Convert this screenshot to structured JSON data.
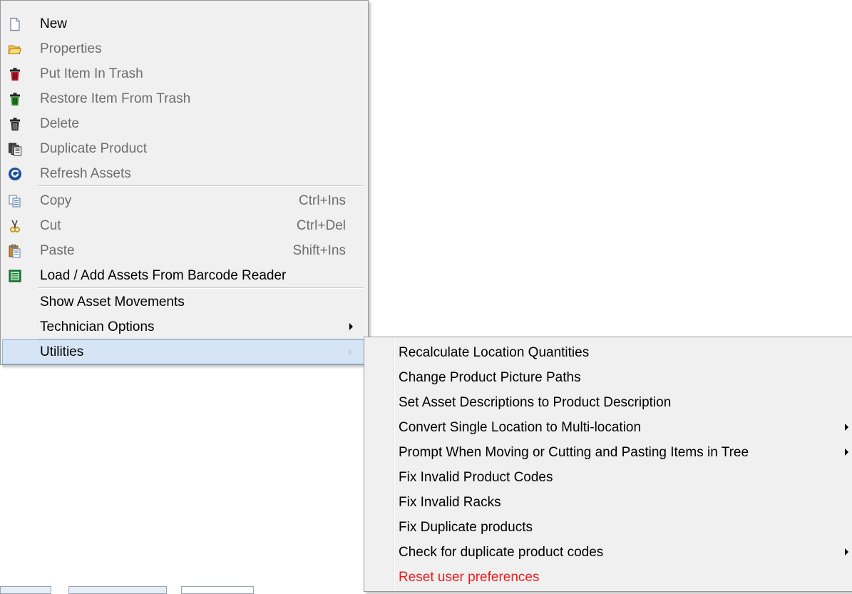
{
  "main_menu": {
    "items": [
      {
        "label": "New",
        "icon": "new-document-icon",
        "enabled": true
      },
      {
        "label": "Properties",
        "icon": "folder-open-icon",
        "enabled": false
      },
      {
        "label": "Put Item In Trash",
        "icon": "trash-red-icon",
        "enabled": false
      },
      {
        "label": "Restore Item From Trash",
        "icon": "trash-green-icon",
        "enabled": false
      },
      {
        "label": "Delete",
        "icon": "trash-black-icon",
        "enabled": false
      },
      {
        "label": "Duplicate Product",
        "icon": "duplicate-icon",
        "enabled": false
      },
      {
        "label": "Refresh Assets",
        "icon": "refresh-icon",
        "enabled": false
      },
      {
        "label": "Copy",
        "icon": "copy-icon",
        "shortcut": "Ctrl+Ins",
        "enabled": false
      },
      {
        "label": "Cut",
        "icon": "scissors-icon",
        "shortcut": "Ctrl+Del",
        "enabled": false
      },
      {
        "label": "Paste",
        "icon": "paste-icon",
        "shortcut": "Shift+Ins",
        "enabled": false
      },
      {
        "label": "Load / Add Assets From Barcode Reader",
        "icon": "barcode-list-icon",
        "enabled": true
      },
      {
        "label": "Show Asset Movements",
        "enabled": true
      },
      {
        "label": "Technician Options",
        "enabled": true,
        "has_submenu": true
      },
      {
        "label": "Utilities",
        "enabled": true,
        "has_submenu": true,
        "highlighted": true
      }
    ]
  },
  "utilities_submenu": {
    "items": [
      {
        "label": "Recalculate Location Quantities"
      },
      {
        "label": "Change Product Picture Paths"
      },
      {
        "label": "Set Asset Descriptions to Product Description"
      },
      {
        "label": "Convert Single Location to Multi-location",
        "has_submenu": true
      },
      {
        "label": "Prompt When Moving or Cutting and Pasting Items in Tree",
        "has_submenu": true
      },
      {
        "label": "Fix Invalid Product Codes"
      },
      {
        "label": "Fix Invalid Racks"
      },
      {
        "label": "Fix Duplicate products"
      },
      {
        "label": "Check for duplicate product codes",
        "has_submenu": true
      },
      {
        "label": "Reset user preferences",
        "color": "#ee1c1c"
      }
    ]
  },
  "colors": {
    "menu_background": "#f0f0f0",
    "highlight_background": "#d5e5f6",
    "highlight_border": "#86b3df",
    "disabled_text": "#6d6d6d",
    "danger_text": "#ee1c1c"
  }
}
